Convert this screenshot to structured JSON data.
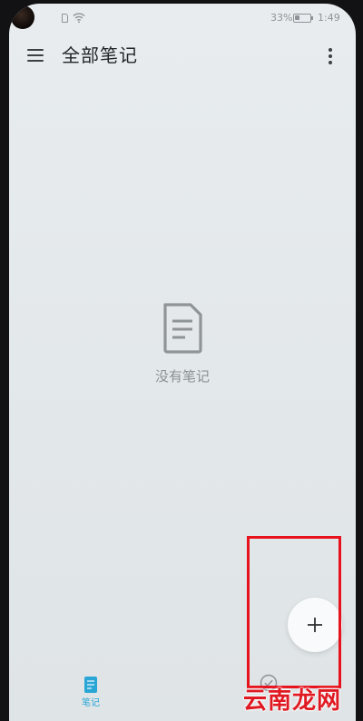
{
  "status_bar": {
    "battery_percent": "33%",
    "battery_level": 0.33,
    "time": "1:49",
    "icons": [
      "camera-hole",
      "sim-icon",
      "wifi-icon",
      "battery-icon"
    ]
  },
  "header": {
    "title": "全部笔记",
    "menu_icon": "hamburger-menu-icon",
    "more_icon": "more-vertical-icon"
  },
  "empty_state": {
    "icon": "document-icon",
    "label": "没有笔记"
  },
  "fab": {
    "icon": "plus-icon"
  },
  "bottom_nav": {
    "items": [
      {
        "label": "笔记",
        "icon": "note-icon",
        "active": true
      },
      {
        "label": "",
        "icon": "checkmark-circle-icon",
        "active": false
      }
    ]
  },
  "watermark": {
    "text": "云南龙网"
  },
  "colors": {
    "accent": "#2aa6d6",
    "highlight": "#e8121d",
    "watermark": "#e01a22",
    "background": "#e6eaec"
  }
}
